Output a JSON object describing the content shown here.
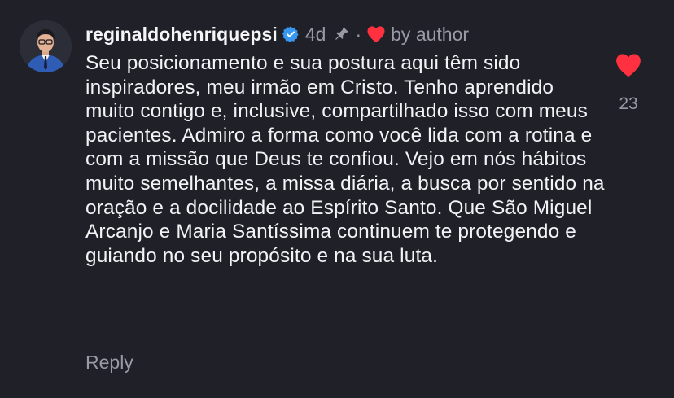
{
  "comment": {
    "username": "reginaldohenriquepsi",
    "time_ago": "4d",
    "separator": "·",
    "by_author_label": "by author",
    "text": "Seu posicionamento e sua postura aqui têm sido inspiradores, meu irmão em Cristo. Tenho aprendido muito contigo e, inclusive, compartilhado isso com meus pacientes. Admiro a forma como você lida com a rotina e com a missão que Deus te confiou. Vejo em nós hábitos muito semelhantes, a missa diária, a busca por sentido na oração e a docilidade ao Espírito Santo. Que São Miguel Arcanjo e Maria Santíssima continuem te protegendo e guiando no seu propósito e na sua luta.",
    "reply_label": "Reply",
    "like_count": "23",
    "liked": true
  },
  "icons": {
    "verified": "verified-badge-icon",
    "pin": "pin-icon",
    "author_heart": "heart-icon",
    "like": "heart-icon"
  },
  "colors": {
    "background": "#202028",
    "text": "#f3f3f6",
    "secondary_text": "#9a9aa6",
    "heart": "#ff3040",
    "verified": "#3897f0"
  }
}
